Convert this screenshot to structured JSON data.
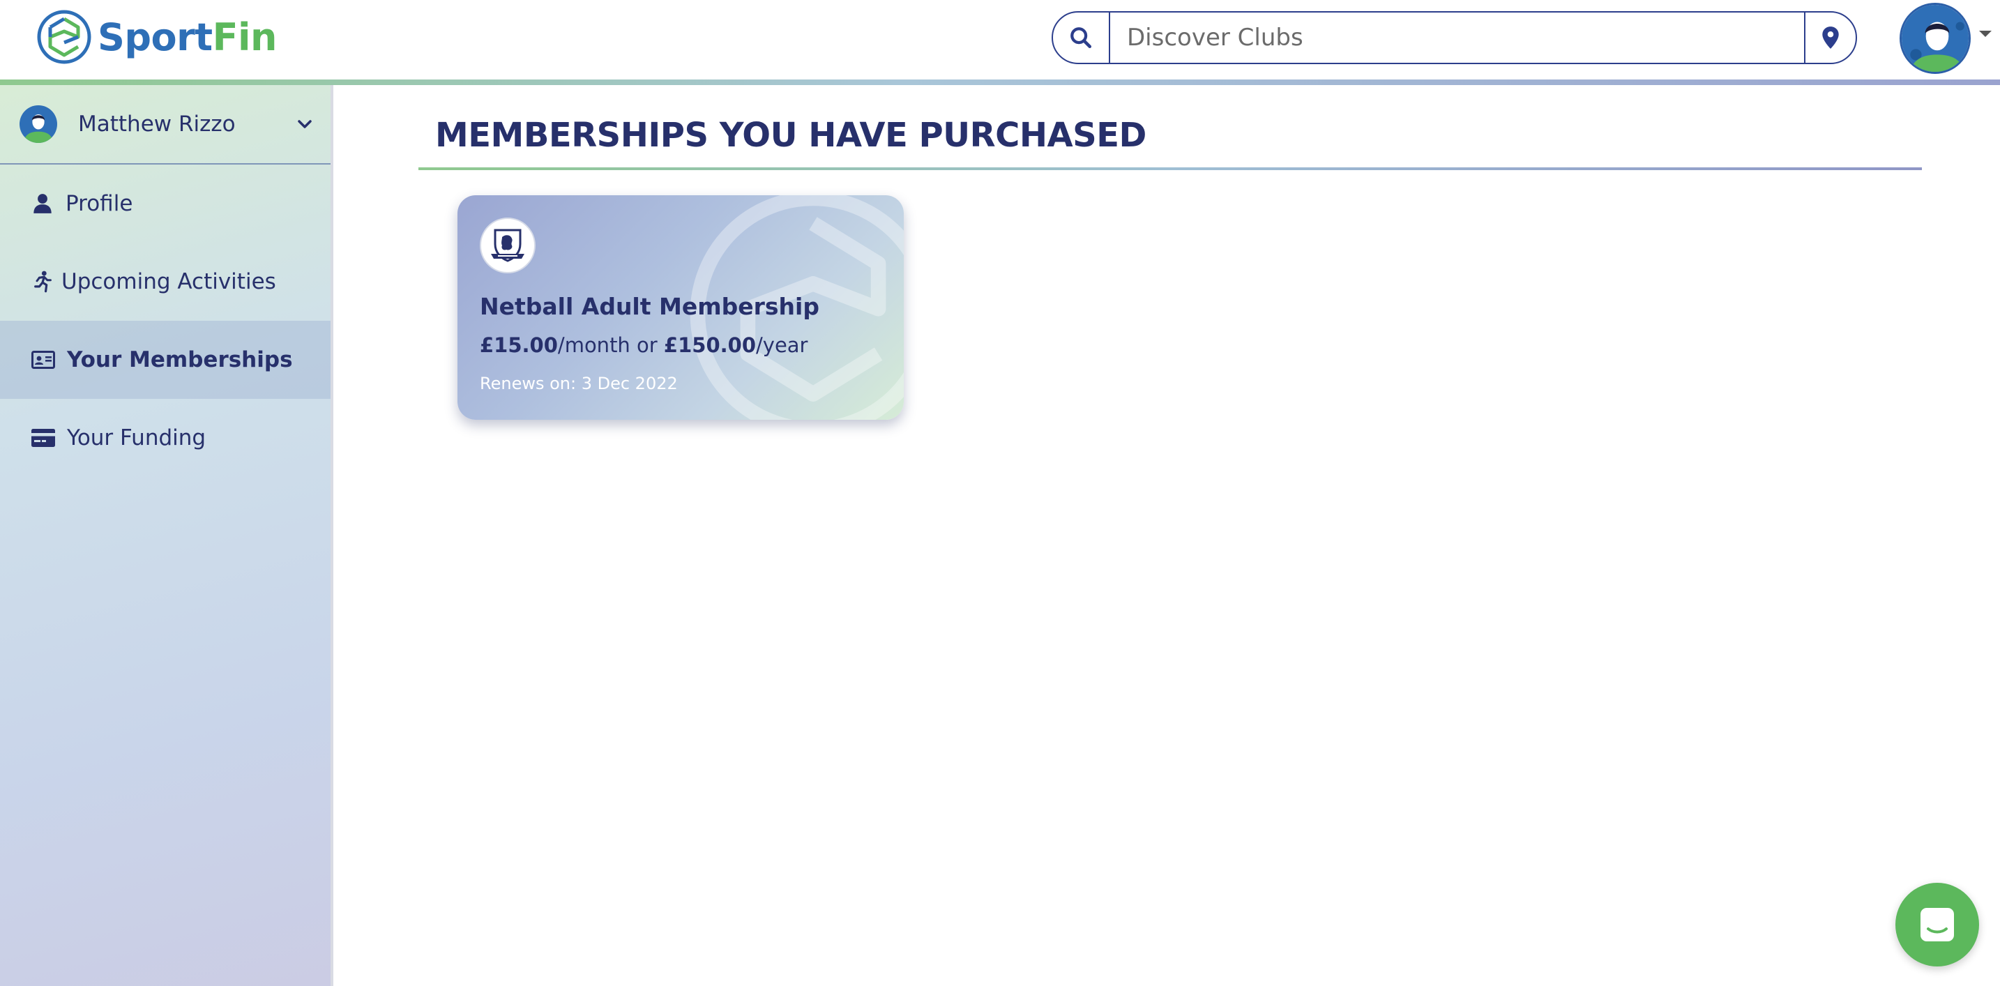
{
  "header": {
    "logo_sport": "Sport",
    "logo_fin": "Fin",
    "search_placeholder": "Discover Clubs"
  },
  "sidebar": {
    "user_name": "Matthew Rizzo",
    "items": [
      {
        "label": "Profile",
        "icon": "person-icon"
      },
      {
        "label": "Upcoming Activities",
        "icon": "running-icon"
      },
      {
        "label": "Your Memberships",
        "icon": "id-card-icon",
        "active": true
      },
      {
        "label": "Your Funding",
        "icon": "credit-card-icon"
      }
    ]
  },
  "main": {
    "title": "MEMBERSHIPS YOU HAVE PURCHASED",
    "memberships": [
      {
        "name": "Netball Adult Membership",
        "monthly_price": "£15.00",
        "monthly_suffix": "/month or ",
        "yearly_price": "£150.00",
        "yearly_suffix": "/year",
        "renews": "Renews on: 3 Dec 2022"
      }
    ]
  },
  "colors": {
    "navy": "#27306b",
    "brand_blue": "#2e6fb7",
    "brand_green": "#5cb85c"
  }
}
